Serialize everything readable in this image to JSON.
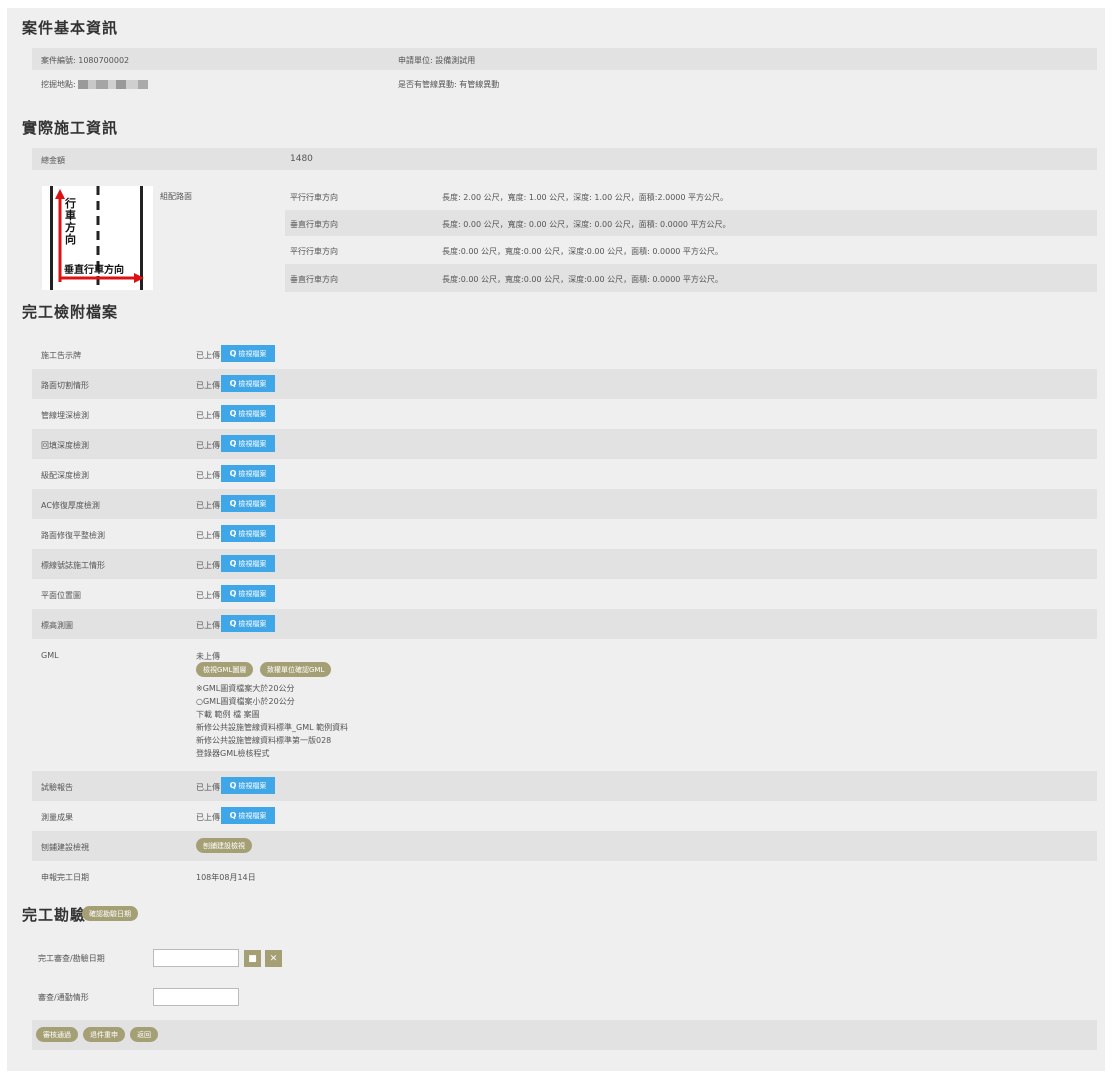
{
  "sections": {
    "basic_title": "案件基本資訊",
    "construction_title": "實際施工資訊",
    "files_title": "完工檢附檔案",
    "inspection_title": "完工勘驗"
  },
  "basic": {
    "case_no": "案件編號: 1080700002",
    "applicant": "申請單位: 設備測試用",
    "address_label": "挖掘地點:",
    "pipeline_change": "是否有管線異動: 有管線異動"
  },
  "construction": {
    "total_label": "總金額",
    "total_value": "1480",
    "road_type": "組配路面",
    "diagram": {
      "text_vertical": [
        "行",
        "車",
        "方",
        "向"
      ],
      "text_horizontal": "垂直行車方向"
    },
    "rows": [
      {
        "dir": "平行行車方向",
        "detail": "長度: 2.00 公尺，寬度: 1.00 公尺，深度: 1.00 公尺，面積:2.0000 平方公尺。"
      },
      {
        "dir": "垂直行車方向",
        "detail": "長度: 0.00 公尺，寬度: 0.00 公尺，深度: 0.00 公尺，面積: 0.0000 平方公尺。"
      },
      {
        "dir": "平行行車方向",
        "detail": "長度:0.00 公尺，寬度:0.00 公尺，深度:0.00 公尺，面積: 0.0000 平方公尺。"
      },
      {
        "dir": "垂直行車方向",
        "detail": "長度:0.00 公尺，寬度:0.00 公尺，深度:0.00 公尺，面積: 0.0000 平方公尺。"
      }
    ]
  },
  "files": {
    "uploaded": "已上傳",
    "view_btn": "檢視檔案",
    "items": [
      "施工告示牌",
      "路面切割情形",
      "管線埋深檢測",
      "回填深度檢測",
      "級配深度檢測",
      "AC修復厚度檢測",
      "路面修復平整檢測",
      "標線號誌施工情形",
      "平面位置圖",
      "標高測圖"
    ],
    "gml": {
      "label": "GML",
      "status": "未上傳",
      "btn1": "檢視GML圖層",
      "btn2": "致權單位確認GML",
      "lines": [
        "※GML圖資檔案大於20公分",
        "○GML圖資檔案小於20公分",
        "下載 範例 檔 案圖",
        "新修公共設施管線資料標準_GML 範例資料",
        "新修公共設施管線資料標準第一版028",
        "登錄器GML檢核程式"
      ]
    },
    "tail_items": [
      "試驗報告",
      "測量成果"
    ],
    "restore_label": "刨鋪建設檢視",
    "restore_btn": "刨鋪建設檢視",
    "date_label": "申報完工日期",
    "date_value": "108年08月14日"
  },
  "inspection": {
    "confirm_btn": "確認勘驗日期",
    "date_label": "完工審查/勘驗日期",
    "date_value": "",
    "note_label": "審查/通勤情形",
    "note_value": "",
    "calendar_icon": "■",
    "clear_icon": "✕",
    "buttons": [
      "審核通過",
      "退件重申",
      "返回"
    ]
  }
}
